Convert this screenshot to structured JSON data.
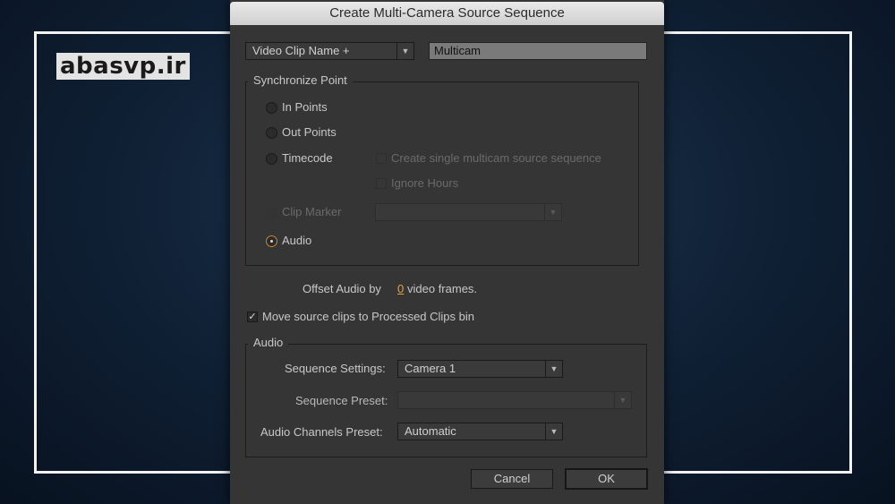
{
  "watermark": "abasvp.ir",
  "dialog": {
    "title": "Create Multi-Camera Source Sequence",
    "name_mode_select": "Video Clip Name +",
    "name_value": "Multicam",
    "sync": {
      "legend": "Synchronize Point",
      "in_points": "In Points",
      "out_points": "Out Points",
      "timecode": "Timecode",
      "create_single": "Create single multicam source sequence",
      "ignore_hours": "Ignore Hours",
      "clip_marker": "Clip Marker",
      "audio": "Audio"
    },
    "offset": {
      "prefix": "Offset Audio by",
      "value": "0",
      "suffix": "video frames."
    },
    "move_clips": "Move source clips to Processed Clips bin",
    "audio": {
      "legend": "Audio",
      "sequence_settings_label": "Sequence Settings:",
      "sequence_settings_value": "Camera 1",
      "sequence_preset_label": "Sequence Preset:",
      "sequence_preset_value": "",
      "channels_label": "Audio Channels Preset:",
      "channels_value": "Automatic"
    },
    "cancel": "Cancel",
    "ok": "OK"
  },
  "icons": {
    "dropdown": "▼",
    "checkmark": "✓"
  },
  "colors": {
    "accent": "#c9882a",
    "link": "#e5a23c"
  }
}
